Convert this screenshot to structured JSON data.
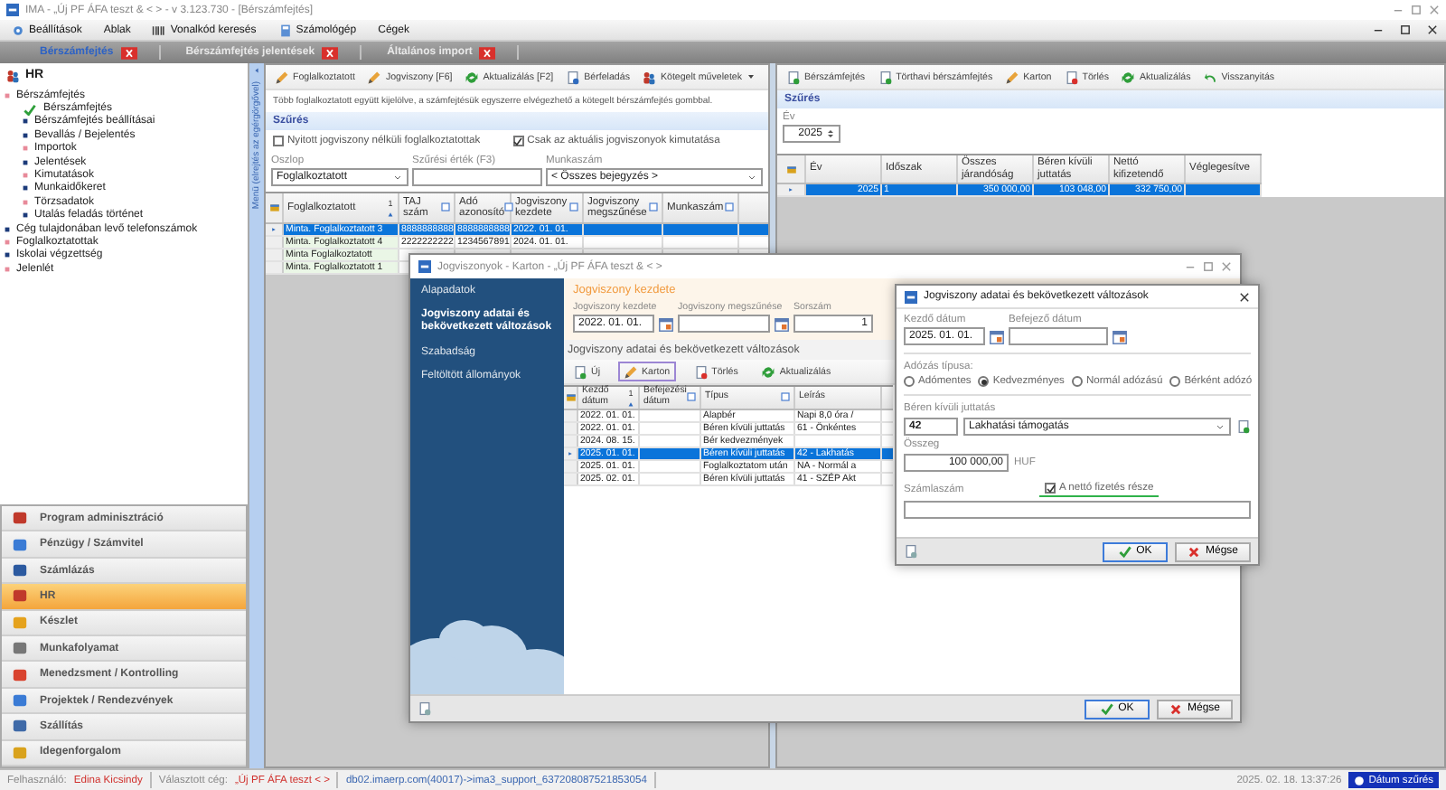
{
  "window": {
    "title": "IMA - „Új PF ÁFA teszt & < > - v 3.123.730 - [Bérszámfejtés]"
  },
  "menu": [
    "Beállítások",
    "Ablak",
    "Vonalkód keresés",
    "Számológép",
    "Cégek"
  ],
  "doc_tabs": [
    {
      "label": "Bérszámfejtés",
      "selected": true
    },
    {
      "label": "Bérszámfejtés jelentések",
      "selected": false
    },
    {
      "label": "Általános import",
      "selected": false
    }
  ],
  "sidebar": {
    "title": "HR",
    "tree": [
      {
        "label": "Bérszámfejtés",
        "kind": "folder",
        "children": [
          {
            "label": "Bérszámfejtés",
            "kind": "active"
          },
          {
            "label": "Bérszámfejtés beállításai",
            "kind": "page"
          },
          {
            "label": "Bevallás / Bejelentés",
            "kind": "page"
          },
          {
            "label": "Importok",
            "kind": "folder"
          },
          {
            "label": "Jelentések",
            "kind": "page"
          },
          {
            "label": "Kimutatások",
            "kind": "folder"
          },
          {
            "label": "Munkaidőkeret",
            "kind": "page"
          },
          {
            "label": "Törzsadatok",
            "kind": "folder"
          },
          {
            "label": "Utalás feladás történet",
            "kind": "page"
          }
        ]
      },
      {
        "label": "Cég tulajdonában levő telefonszámok",
        "kind": "page"
      },
      {
        "label": "Foglalkoztatottak",
        "kind": "folder"
      },
      {
        "label": "Iskolai végzettség",
        "kind": "page"
      },
      {
        "label": "Jelenlét",
        "kind": "folder"
      }
    ],
    "strip": "Menü (elrejtés az egérgörgővel)",
    "modules": [
      {
        "label": "Program adminisztráció",
        "selected": false
      },
      {
        "label": "Pénzügy / Számvitel",
        "selected": false
      },
      {
        "label": "Számlázás",
        "selected": false
      },
      {
        "label": "HR",
        "selected": true
      },
      {
        "label": "Készlet",
        "selected": false
      },
      {
        "label": "Munkafolyamat",
        "selected": false
      },
      {
        "label": "Menedzsment / Kontrolling",
        "selected": false
      },
      {
        "label": "Projektek / Rendezvények",
        "selected": false
      },
      {
        "label": "Szállítás",
        "selected": false
      },
      {
        "label": "Idegenforgalom",
        "selected": false
      }
    ]
  },
  "employees": {
    "toolbar": [
      "Foglalkoztatott",
      "Jogviszony [F6]",
      "Aktualizálás [F2]",
      "Bérfeladás",
      "Kötegelt műveletek"
    ],
    "info": "Több foglalkoztatott együtt kijelölve, a számfejtésük egyszerre elvégezhető a kötegelt bérszámfejtés gombbal.",
    "filter_title": "Szűrés",
    "options": [
      {
        "label": "Nyitott jogviszony nélküli foglalkoztatottak",
        "checked": false
      },
      {
        "label": "Csak az aktuális jogviszonyok kimutatása",
        "checked": true
      }
    ],
    "fields": [
      {
        "label": "Oszlop",
        "value": "Foglalkoztatott",
        "kind": "select"
      },
      {
        "label": "Szűrési érték (F3)",
        "kind": "text"
      },
      {
        "label": "Munkaszám",
        "value": "< Összes bejegyzés >",
        "kind": "select"
      }
    ],
    "table": {
      "columns": [
        {
          "label": "Foglalkoztatott",
          "sort": "1"
        },
        {
          "label": "TAJ szám",
          "filter": true
        },
        {
          "label": "Adó azonosító",
          "filter": true
        },
        {
          "label": "Jogviszony kezdete",
          "filter": true
        },
        {
          "label": "Jogviszony megszűnése",
          "filter": true
        },
        {
          "label": "Munkaszám",
          "filter": true
        }
      ],
      "rows": [
        {
          "cells": [
            "Minta. Foglalkoztatott 3",
            "8888888888",
            "8888888888",
            "2022. 01. 01."
          ],
          "selected": true
        },
        {
          "cells": [
            "Minta. Foglalkoztatott 4",
            "2222222222",
            "1234567891",
            "2024. 01. 01."
          ],
          "selected": false
        },
        {
          "cells": [
            "Minta Foglalkoztatott"
          ],
          "selected": false
        },
        {
          "cells": [
            "Minta. Foglalkoztatott 1"
          ],
          "selected": false
        }
      ]
    }
  },
  "payroll": {
    "toolbar": [
      "Bérszámfejtés",
      "Törthavi bérszámfejtés",
      "Karton",
      "Törlés",
      "Aktualizálás",
      "Visszanyitás"
    ],
    "filter_title": "Szűrés",
    "year_label": "Év",
    "year": "2025",
    "table": {
      "columns": [
        {
          "label": "Év"
        },
        {
          "label": "Időszak"
        },
        {
          "label": "Összes járandóság"
        },
        {
          "label": "Béren kívüli juttatás"
        },
        {
          "label": "Nettó kifizetendő"
        },
        {
          "label": "Véglegesítve"
        }
      ],
      "rows": [
        {
          "cells": [
            "2025",
            "1",
            "350 000,00",
            "103 048,00",
            "332 750,00"
          ],
          "selected": true
        }
      ]
    }
  },
  "contract_window": {
    "title": "Jogviszonyok - Karton - „Új PF ÁFA teszt & < >",
    "nav": [
      {
        "label": "Alapadatok",
        "selected": false
      },
      {
        "label": "Jogviszony adatai és bekövetkezett változások",
        "selected": true
      },
      {
        "label": "Szabadság",
        "selected": false
      },
      {
        "label": "Feltöltött állományok",
        "selected": false
      }
    ],
    "start_title": "Jogviszony kezdete",
    "fields": [
      {
        "label": "Jogviszony kezdete",
        "value": "2022. 01. 01.",
        "kind": "date"
      },
      {
        "label": "Jogviszony megszűnése",
        "kind": "date"
      },
      {
        "label": "Sorszám",
        "value": "1",
        "kind": "number"
      }
    ],
    "changes_title": "Jogviszony adatai és bekövetkezett változások",
    "toolbar": [
      {
        "label": "Új",
        "selected": false
      },
      {
        "label": "Karton",
        "selected": true
      },
      {
        "label": "Törlés",
        "selected": false
      },
      {
        "label": "Aktualizálás",
        "selected": false
      }
    ],
    "table": {
      "columns": [
        {
          "label": "Kezdő dátum",
          "sort": "1"
        },
        {
          "label": "Befejezési dátum",
          "filter": true
        },
        {
          "label": "Típus",
          "filter": true
        },
        {
          "label": "Leírás"
        }
      ],
      "rows": [
        {
          "cells": [
            "2022. 01. 01.",
            "",
            "Alapbér",
            "Napi 8,0 óra /"
          ],
          "selected": false
        },
        {
          "cells": [
            "2022. 01. 01.",
            "",
            "Béren kívüli juttatás",
            "61 - Önkéntes"
          ],
          "selected": false
        },
        {
          "cells": [
            "2024. 08. 15.",
            "",
            "Bér kedvezmények"
          ],
          "selected": false
        },
        {
          "cells": [
            "2025. 01. 01.",
            "",
            "Béren kívüli juttatás",
            "42 - Lakhatás"
          ],
          "selected": true
        },
        {
          "cells": [
            "2025. 01. 01.",
            "",
            "Foglalkoztatom után",
            "NA - Normál a"
          ],
          "selected": false
        },
        {
          "cells": [
            "2025. 02. 01.",
            "",
            "Béren kívüli juttatás",
            "41 - SZÉP Akt"
          ],
          "selected": false
        }
      ]
    },
    "buttons": [
      "OK",
      "Mégse"
    ]
  },
  "change_dialog": {
    "title": "Jogviszony adatai és bekövetkezett változások",
    "start_label": "Kezdő dátum",
    "start": "2025. 01. 01.",
    "end_label": "Befejező dátum",
    "tax_label": "Adózás típusa:",
    "tax_options": [
      {
        "label": "Adómentes",
        "selected": false
      },
      {
        "label": "Kedvezményes",
        "selected": true
      },
      {
        "label": "Normál adózású",
        "selected": false
      },
      {
        "label": "Bérként adózó",
        "selected": false
      }
    ],
    "benefit_label": "Béren kívüli juttatás",
    "benefit_code": "42",
    "benefit": "Lakhatási támogatás",
    "amount_label": "Összeg",
    "amount": "100 000,00",
    "currency": "HUF",
    "account_label": "Számlaszám",
    "net_part": {
      "label": "A nettó fizetés része",
      "checked": true
    },
    "buttons": [
      "OK",
      "Mégse"
    ]
  },
  "status_bar": {
    "user_label": "Felhasználó:",
    "user": "Edina Kicsindy",
    "company_label": "Választott cég:",
    "company": "„Új PF ÁFA teszt < >",
    "connection": "db02.imaerp.com(40017)->ima3_support_637208087521853054",
    "datetime": "2025. 02. 18. 13:37:26",
    "date_filter": "Dátum szűrés"
  }
}
